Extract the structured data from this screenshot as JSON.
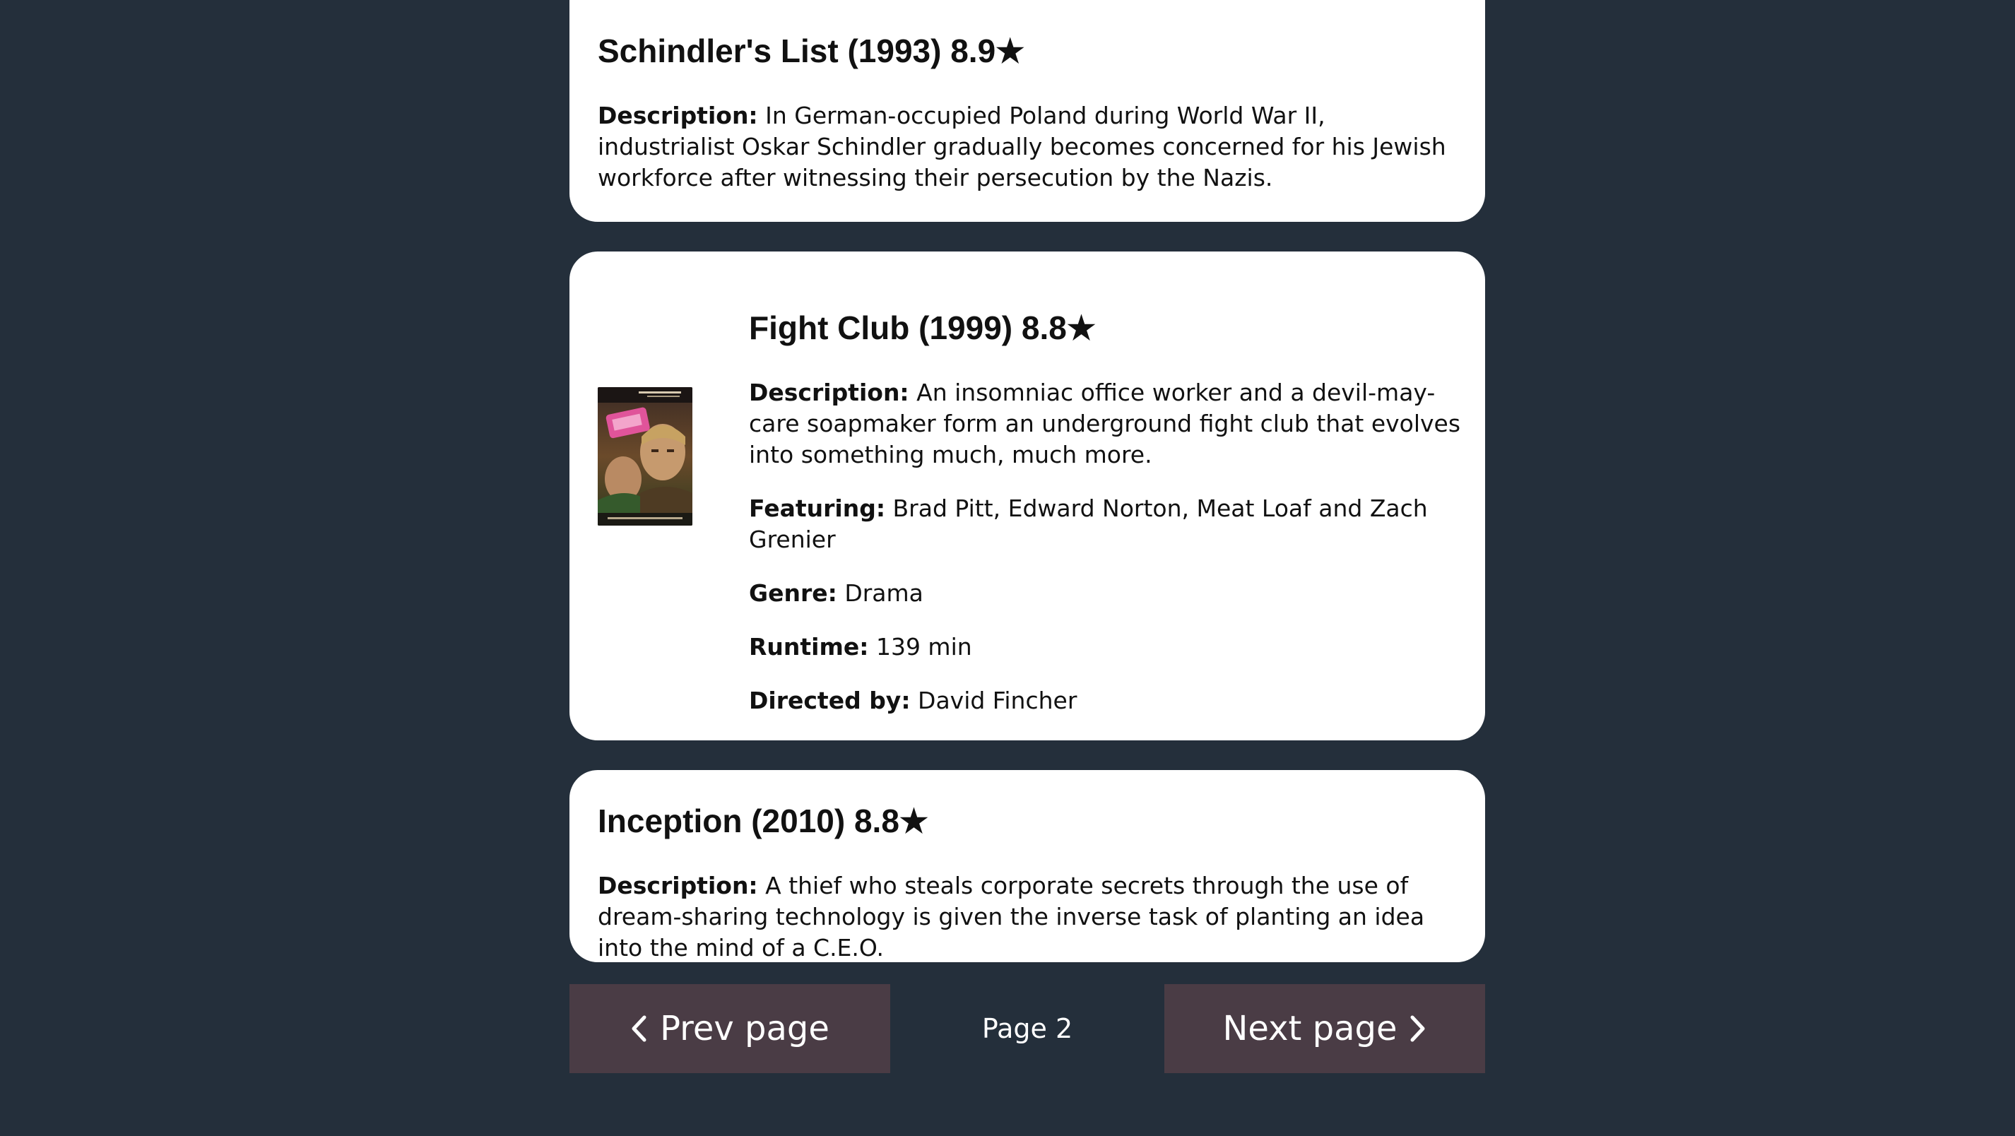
{
  "movies": [
    {
      "title": "Schindler's List (1993) 8.9★",
      "description_label": "Description:",
      "description": "In German-occupied Poland during World War II, industrialist Oskar Schindler gradually becomes concerned for his Jewish workforce after witnessing their persecution by the Nazis."
    },
    {
      "title": "Fight Club (1999) 8.8★",
      "poster_icon": "movie-poster-image",
      "description_label": "Description:",
      "description": "An insomniac office worker and a devil-may-care soapmaker form an underground fight club that evolves into something much, much more.",
      "featuring_label": "Featuring:",
      "featuring": "Brad Pitt, Edward Norton, Meat Loaf and Zach Grenier",
      "genre_label": "Genre:",
      "genre": "Drama",
      "runtime_label": "Runtime:",
      "runtime": "139 min",
      "director_label": "Directed by:",
      "director": "David Fincher"
    },
    {
      "title": "Inception (2010) 8.8★",
      "description_label": "Description:",
      "description": "A thief who steals corporate secrets through the use of dream-sharing technology is given the inverse task of planting an idea into the mind of a C.E.O."
    }
  ],
  "pagination": {
    "prev_label": "Prev page",
    "page_label": "Page 2",
    "next_label": "Next page"
  },
  "colors": {
    "background": "#242f3b",
    "card": "#ffffff",
    "button": "#4a3c45",
    "text": "#111111"
  }
}
